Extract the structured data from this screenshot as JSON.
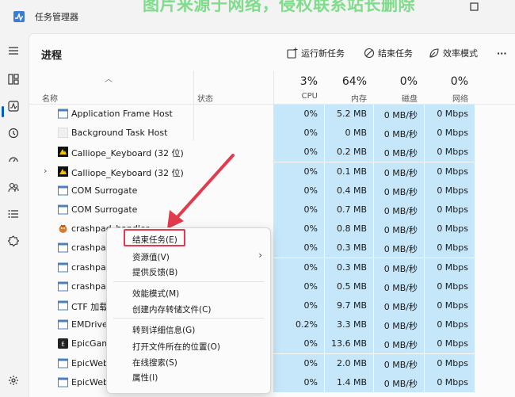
{
  "app": {
    "title": "任务管理器"
  },
  "watermark": "图片来源于网络，侵权联系站长删除",
  "toolbar": {
    "page_title": "进程",
    "run_new_task": "运行新任务",
    "end_task": "结束任务",
    "efficiency_mode": "效率模式",
    "more": "···"
  },
  "columns": {
    "name": "名称",
    "status": "状态",
    "metrics": [
      {
        "pct": "3%",
        "label": "CPU"
      },
      {
        "pct": "64%",
        "label": "内存"
      },
      {
        "pct": "0%",
        "label": "磁盘"
      },
      {
        "pct": "0%",
        "label": "网络"
      }
    ]
  },
  "processes": [
    {
      "name": "Application Frame Host",
      "cpu": "0%",
      "mem": "5.2 MB",
      "disk": "0 MB/秒",
      "net": "0 Mbps",
      "icon": "window-icon"
    },
    {
      "name": "Background Task Host",
      "cpu": "0%",
      "mem": "0 MB",
      "disk": "0 MB/秒",
      "net": "0 Mbps",
      "icon": "blank-icon"
    },
    {
      "name": "Calliope_Keyboard (32 位)",
      "cpu": "0%",
      "mem": "0.2 MB",
      "disk": "0 MB/秒",
      "net": "0 Mbps",
      "icon": "keyboard-app-icon"
    },
    {
      "name": "Calliope_Keyboard (32 位)",
      "cpu": "0%",
      "mem": "0.1 MB",
      "disk": "0 MB/秒",
      "net": "0 Mbps",
      "icon": "keyboard-app-icon",
      "expandable": true
    },
    {
      "name": "COM Surrogate",
      "cpu": "0%",
      "mem": "0.4 MB",
      "disk": "0 MB/秒",
      "net": "0 Mbps",
      "icon": "window-icon"
    },
    {
      "name": "COM Surrogate",
      "cpu": "0%",
      "mem": "0.7 MB",
      "disk": "0 MB/秒",
      "net": "0 Mbps",
      "icon": "window-icon"
    },
    {
      "name": "crashpad_handler",
      "cpu": "0%",
      "mem": "0.8 MB",
      "disk": "0 MB/秒",
      "net": "0 Mbps",
      "icon": "crashpad-icon"
    },
    {
      "name": "crashpad",
      "cpu": "0%",
      "mem": "0.3 MB",
      "disk": "0 MB/秒",
      "net": "0 Mbps",
      "icon": "window-icon"
    },
    {
      "name": "crashpad",
      "cpu": "0%",
      "mem": "0.3 MB",
      "disk": "0 MB/秒",
      "net": "0 Mbps",
      "icon": "window-icon"
    },
    {
      "name": "crashpad",
      "cpu": "0%",
      "mem": "0.5 MB",
      "disk": "0 MB/秒",
      "net": "0 Mbps",
      "icon": "window-icon"
    },
    {
      "name": "CTF 加载",
      "cpu": "0%",
      "mem": "9.7 MB",
      "disk": "0 MB/秒",
      "net": "0 Mbps",
      "icon": "window-icon"
    },
    {
      "name": "EMDriver",
      "cpu": "0.2%",
      "mem": "3.3 MB",
      "disk": "0 MB/秒",
      "net": "0 Mbps",
      "icon": "window-icon"
    },
    {
      "name": "EpicGam",
      "cpu": "0%",
      "mem": "13.6 MB",
      "disk": "0 MB/秒",
      "net": "0 Mbps",
      "icon": "epic-icon"
    },
    {
      "name": "EpicWeb",
      "cpu": "0%",
      "mem": "2.0 MB",
      "disk": "0 MB/秒",
      "net": "0 Mbps",
      "icon": "window-icon"
    },
    {
      "name": "EpicWeb",
      "cpu": "0%",
      "mem": "1.4 MB",
      "disk": "0 MB/秒",
      "net": "0 Mbps",
      "icon": "window-icon"
    }
  ],
  "context_menu": {
    "items": [
      {
        "label": "结束任务(E)"
      },
      {
        "label": "资源值(V)",
        "submenu": true
      },
      {
        "label": "提供反馈(B)"
      },
      {
        "label": "效能模式(M)"
      },
      {
        "label": "创建内存转储文件(C)"
      },
      {
        "label": "转到详细信息(G)"
      },
      {
        "label": "打开文件所在的位置(O)"
      },
      {
        "label": "在线搜索(S)"
      },
      {
        "label": "属性(I)"
      }
    ]
  },
  "colors": {
    "accent": "#005fb8",
    "highlight_cell": "#c6e7fa",
    "annotation_red": "#e23b4d"
  }
}
